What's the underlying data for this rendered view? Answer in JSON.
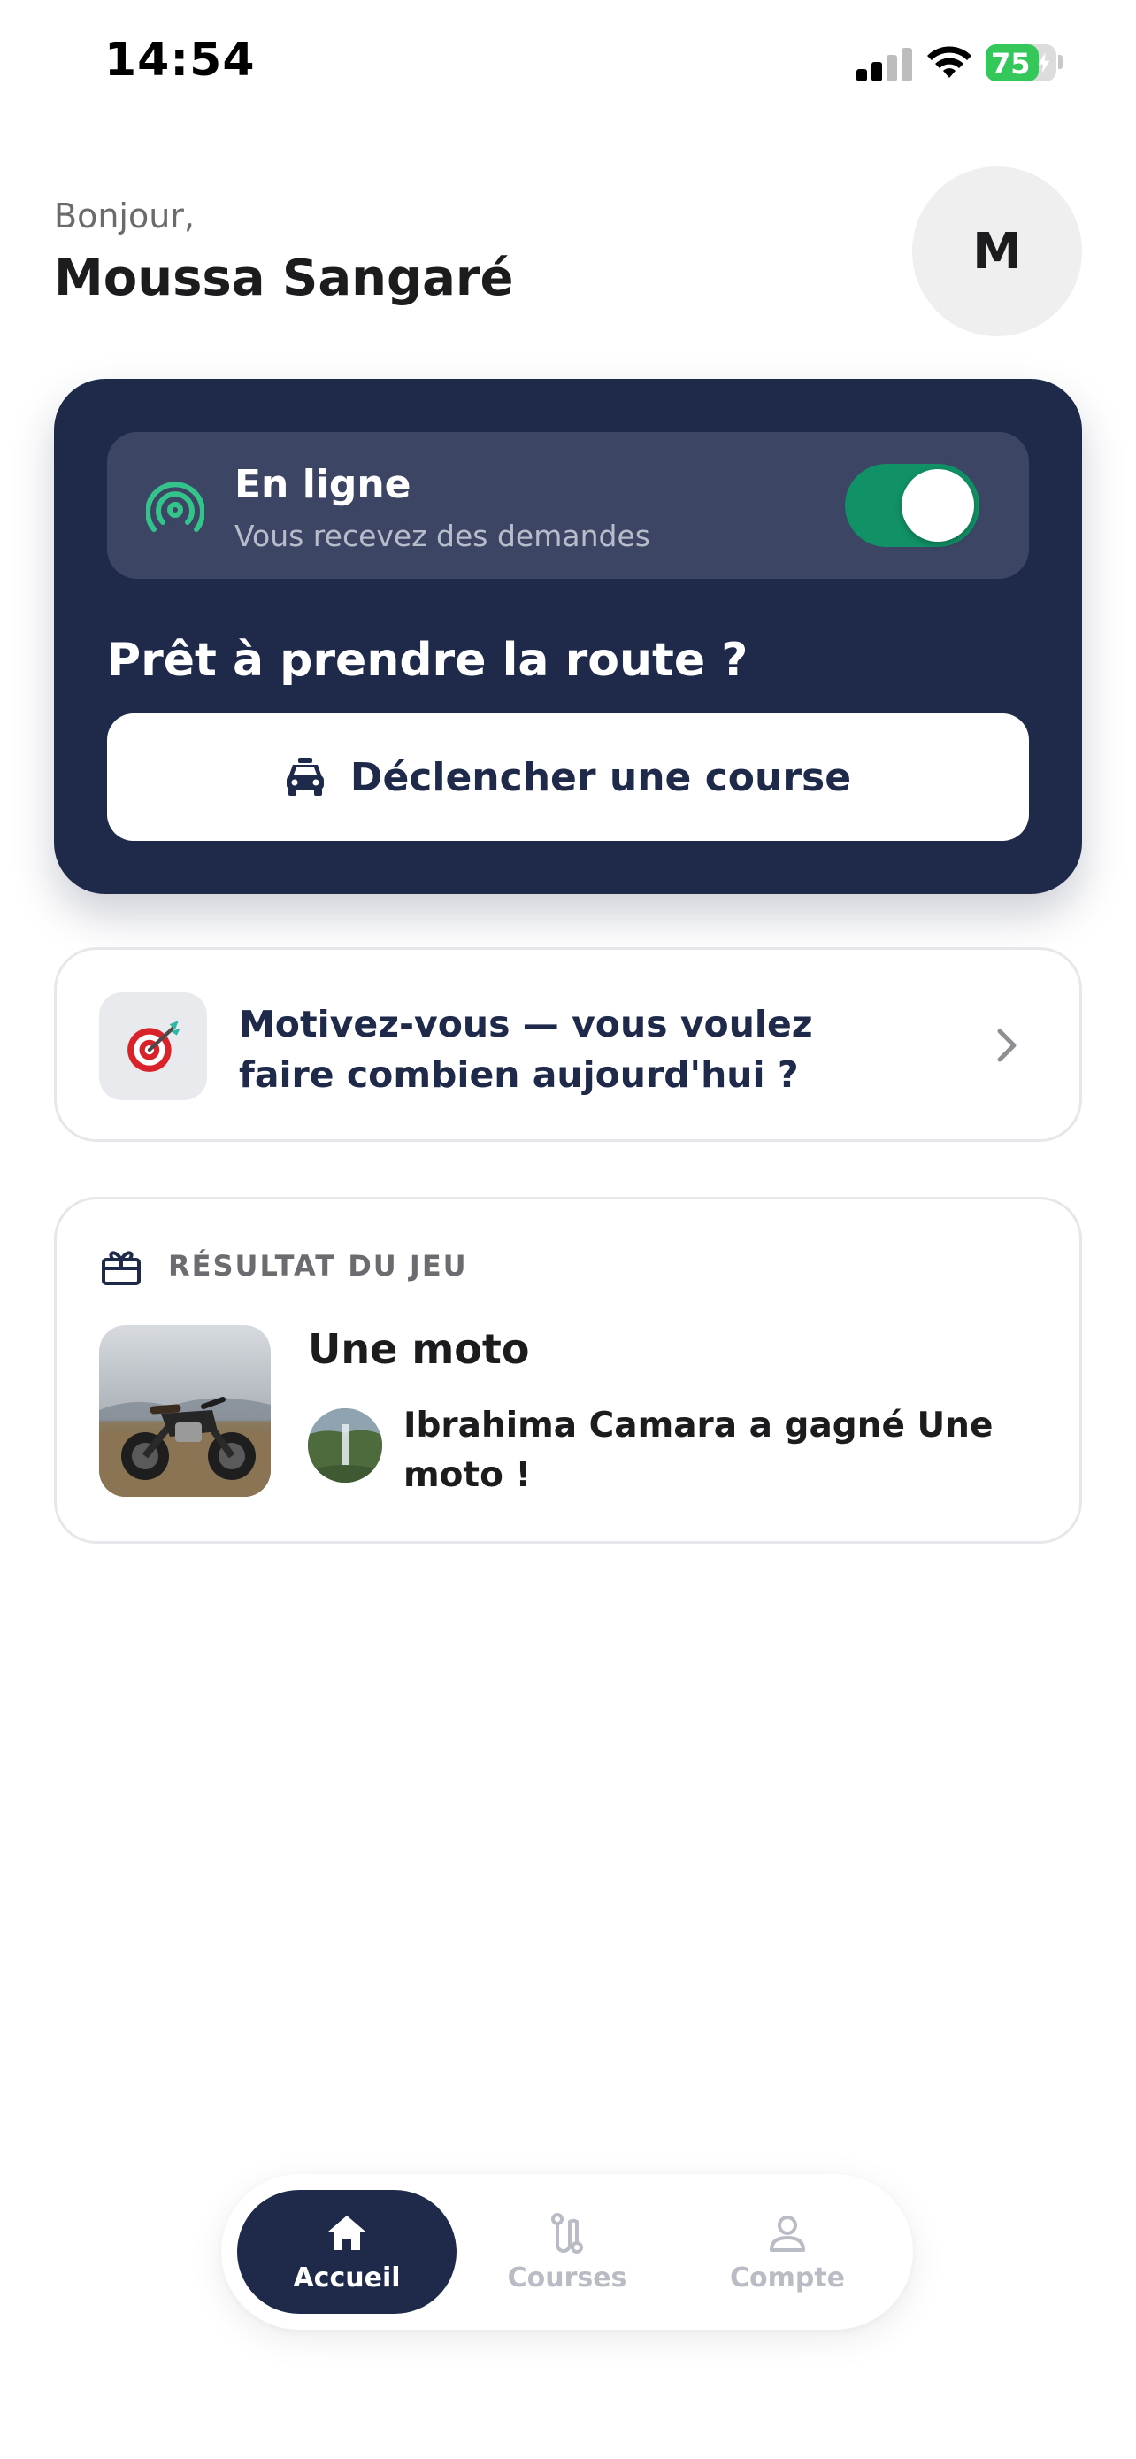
{
  "status_bar": {
    "time": "14:54",
    "battery": "75",
    "battery_percent": 75
  },
  "header": {
    "greeting": "Bonjour,",
    "user_name": "Moussa Sangaré",
    "avatar_initial": "M"
  },
  "status_card": {
    "online_title": "En ligne",
    "online_subtitle": "Vous recevez des demandes",
    "online_toggle_on": true,
    "ready_text": "Prêt à prendre la route ?",
    "trigger_button_label": "Déclencher une course",
    "icons": {
      "online": "radio-signal-icon",
      "trigger": "taxi-icon"
    }
  },
  "motivation": {
    "text": "Motivez-vous — vous voulez faire combien aujourd'hui ?",
    "icons": {
      "target": "target-dart-icon",
      "chevron": "chevron-right-icon"
    }
  },
  "game_result": {
    "section_label": "RÉSULTAT DU JEU",
    "prize_title": "Une moto",
    "winner_text": "Ibrahima Camara a gagné Une moto !",
    "icons": {
      "section": "gift-icon"
    }
  },
  "bottom_nav": {
    "items": [
      {
        "label": "Accueil",
        "icon": "home-icon",
        "active": true
      },
      {
        "label": "Courses",
        "icon": "route-icon",
        "active": false
      },
      {
        "label": "Compte",
        "icon": "user-icon",
        "active": false
      }
    ]
  },
  "colors": {
    "navy": "#1f2a4b",
    "online_green": "#119166",
    "battery_green": "#34c759",
    "card_border": "#e6e7ea"
  }
}
